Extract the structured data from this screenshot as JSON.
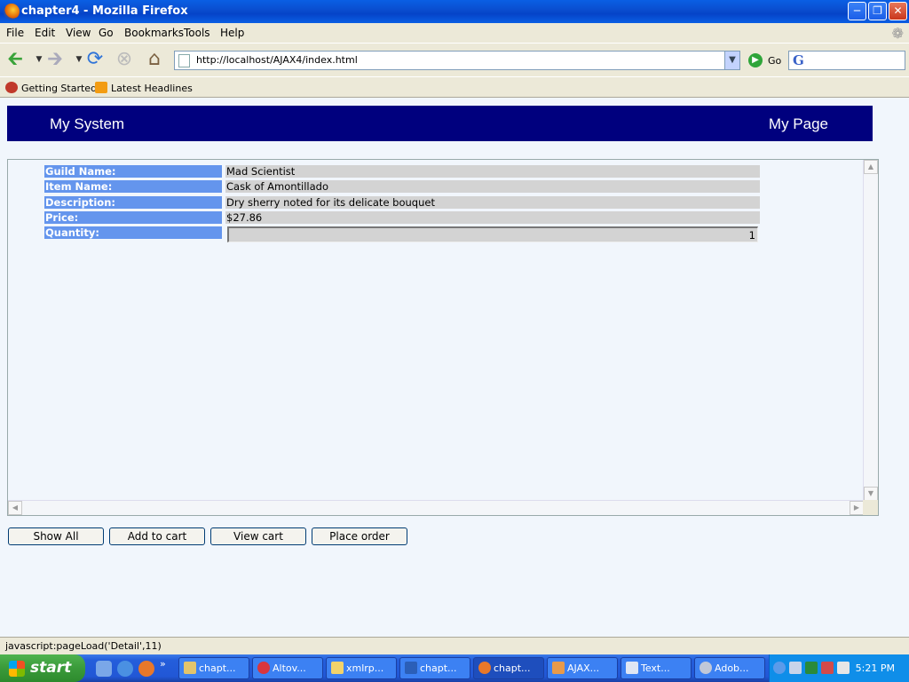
{
  "window": {
    "title": "chapter4 - Mozilla Firefox"
  },
  "menu": [
    "File",
    "Edit",
    "View",
    "Go",
    "Bookmarks",
    "Tools",
    "Help"
  ],
  "nav": {
    "url": "http://localhost/AJAX4/index.html",
    "go_label": "Go",
    "search_logo": "G"
  },
  "bookmarks": [
    "Getting Started",
    "Latest Headlines"
  ],
  "header": {
    "system": "My System",
    "page": "My Page"
  },
  "detail": {
    "rows": [
      {
        "label": "Guild Name:",
        "value": "Mad Scientist"
      },
      {
        "label": "Item Name:",
        "value": "Cask of Amontillado"
      },
      {
        "label": "Description:",
        "value": "Dry sherry noted for its delicate bouquet"
      },
      {
        "label": "Price:",
        "value": "$27.86"
      }
    ],
    "quantity": {
      "label": "Quantity:",
      "value": "1"
    }
  },
  "actions": [
    "Show All",
    "Add to cart",
    "View cart",
    "Place order"
  ],
  "status": "javascript:pageLoad('Detail',11)",
  "taskbar": {
    "start": "start",
    "tasks": [
      "chapt...",
      "Altov...",
      "xmlrp...",
      "chapt...",
      "chapt...",
      "AJAX...",
      "Text...",
      "Adob..."
    ],
    "clock": "5:21 PM"
  },
  "colors": {
    "header_bg": "#00007e",
    "label_bg": "#6495ed",
    "value_bg": "#d3d3d3",
    "page_bg": "#f1f6fc"
  }
}
